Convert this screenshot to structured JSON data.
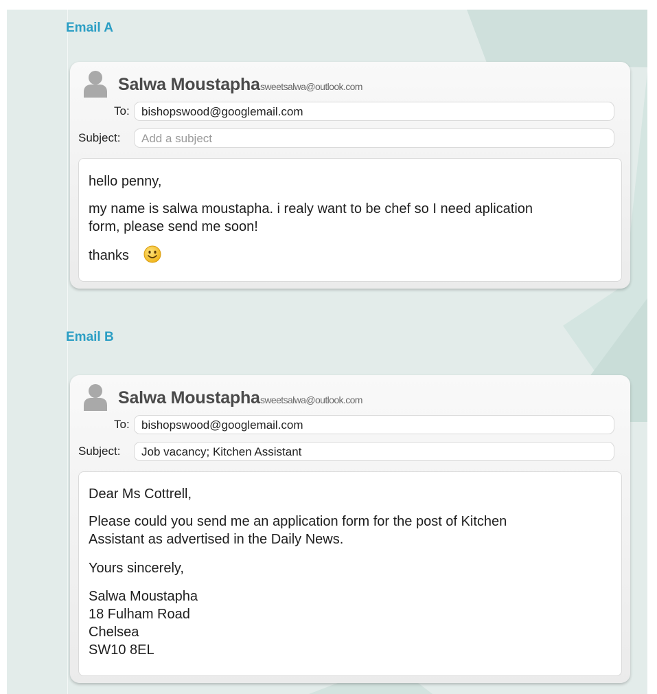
{
  "emails": [
    {
      "heading": "Email A",
      "sender_name": "Salwa Moustapha",
      "sender_email": "sweetsalwa@outlook.com",
      "to_label": "To:",
      "to_value": "bishopswood@googlemail.com",
      "subject_label": "Subject:",
      "subject_value": "",
      "subject_placeholder": "Add a subject",
      "body": {
        "greeting": "hello penny,",
        "line1": "my name is salwa moustapha. i realy want to be chef so I need aplication",
        "line2": "form, please send me soon!",
        "signoff": "thanks",
        "signoff_icon": "smiley-face-icon"
      }
    },
    {
      "heading": "Email B",
      "sender_name": "Salwa Moustapha",
      "sender_email": "sweetsalwa@outlook.com",
      "to_label": "To:",
      "to_value": "bishopswood@googlemail.com",
      "subject_label": "Subject:",
      "subject_value": "Job vacancy; Kitchen Assistant",
      "body": {
        "greeting": "Dear Ms Cottrell,",
        "line1": "Please could you send me an application form for the post of Kitchen",
        "line2": "Assistant as advertised in the Daily News.",
        "closing": "Yours sincerely,",
        "signature": [
          "Salwa Moustapha",
          "18 Fulham Road",
          "Chelsea",
          "SW10 8EL"
        ]
      }
    }
  ],
  "colors": {
    "heading": "#2b9ec4",
    "panel_background": "#e3ecea",
    "card_background": "#f2f2f2",
    "avatar": "#a9a9a9",
    "smiley": "#f6c22e"
  },
  "icons": [
    "user-avatar-icon",
    "smiley-face-icon"
  ]
}
